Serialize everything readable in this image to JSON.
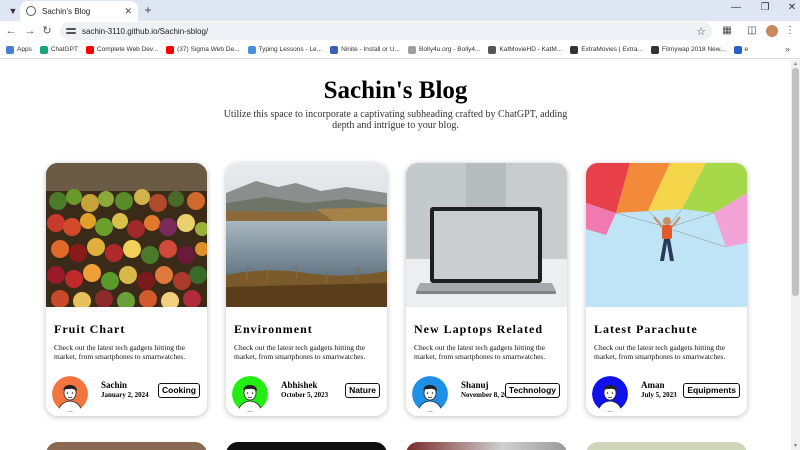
{
  "browser": {
    "tab_title": "Sachin's Blog",
    "url": "sachin-3110.github.io/Sachin-sblog/",
    "bookmarks": [
      {
        "label": "Apps",
        "color": "#4a7bd6"
      },
      {
        "label": "ChatGPT",
        "color": "#19a37f"
      },
      {
        "label": "Complete Web Dev...",
        "color": "#ff0000"
      },
      {
        "label": "(37) Sigma Web De...",
        "color": "#ff0000"
      },
      {
        "label": "Typing Lessons - Le...",
        "color": "#4a8fd8"
      },
      {
        "label": "Ninite - Install or U...",
        "color": "#3b5fb5"
      },
      {
        "label": "Bolly4u.org - Bolly4...",
        "color": "#9e9e9e"
      },
      {
        "label": "KatMovieHD - KatM...",
        "color": "#555555"
      },
      {
        "label": "ExtraMovies | Extra...",
        "color": "#333333"
      },
      {
        "label": "Filmywap 2018 New...",
        "color": "#333333"
      },
      {
        "label": "e",
        "color": "#2a62c9"
      }
    ]
  },
  "page": {
    "title": "Sachin's Blog",
    "subtitle": "Utilize this space to incorporate a captivating subheading crafted by ChatGPT, adding depth and intrigue to your blog."
  },
  "cards": [
    {
      "title": "Fruit Chart",
      "description": "Check out the latest tech gadgets hitting the market, from smartphones to smartwatches.",
      "author": "Sachin",
      "date": "January 2, 2024",
      "tag": "Cooking",
      "avatar_color": "#f2743e"
    },
    {
      "title": "Environment",
      "description": "Check out the latest tech gadgets hitting the market, from smartphones to smartwatches.",
      "author": "Abhishek",
      "date": "October 5, 2023",
      "tag": "Nature",
      "avatar_color": "#22ee11"
    },
    {
      "title": "New Laptops Related",
      "description": "Check out the latest tech gadgets hitting the market, from smartphones to smartwatches.",
      "author": "Shanuj",
      "date": "November 8, 2023",
      "tag": "Technology",
      "avatar_color": "#1e90e6"
    },
    {
      "title": "Latest Parachute",
      "description": "Check out the latest tech gadgets hitting the market, from smartphones to smartwatches.",
      "author": "Aman",
      "date": "July 5, 2023",
      "tag": "Equipments",
      "avatar_color": "#1111ee"
    }
  ],
  "icons": {
    "tab_menu": "chevron-down-icon",
    "close": "close-icon",
    "new_tab": "plus-icon",
    "back": "arrow-left-icon",
    "forward": "arrow-right-icon",
    "reload": "reload-icon",
    "bookmark": "star-icon",
    "extensions": "puzzle-icon",
    "menu": "kebab-icon"
  }
}
